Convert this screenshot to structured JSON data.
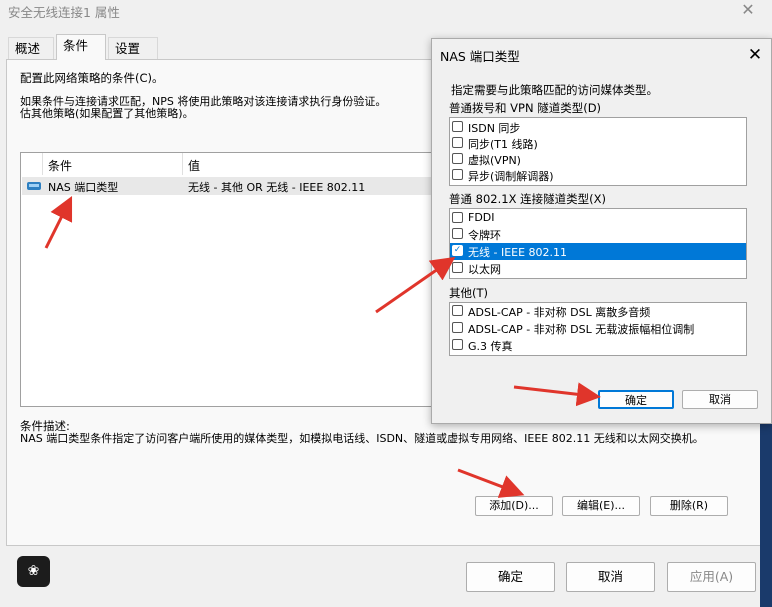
{
  "main": {
    "title": "安全无线连接1 属性",
    "close_glyph": "✕",
    "tabs": [
      {
        "label": "概述"
      },
      {
        "label": "条件"
      },
      {
        "label": "设置"
      }
    ],
    "heading": "配置此网络策略的条件(C)。",
    "description": "如果条件与连接请求匹配，NPS 将使用此策略对该连接请求执行身份验证。如果条件与连接请求不匹配，NPS 将跳过此策略并评估其他策略(如果配置了其他策略)。",
    "description_visible": "如果条件与连接请求匹配，NPS 将使用此策略对该连接请求执行身份验证。\n估其他策略(如果配置了其他策略)。",
    "table": {
      "headers": [
        "条件",
        "值"
      ],
      "rows": [
        {
          "condition": "NAS 端口类型",
          "value": "无线 - 其他 OR 无线 - IEEE 802.11"
        }
      ]
    },
    "condition_desc_label": "条件描述:",
    "condition_desc": "NAS 端口类型条件指定了访问客户端所使用的媒体类型，如模拟电话线、ISDN、隧道或虚拟专用网络、IEEE 802.11 无线和以太网交换机。",
    "buttons": {
      "add": "添加(D)...",
      "edit": "编辑(E)...",
      "delete": "删除(R)",
      "ok": "确定",
      "cancel": "取消",
      "apply": "应用(A)"
    },
    "app_icon_glyph": "❀"
  },
  "dialog": {
    "title": "NAS 端口类型",
    "close_glyph": "✕",
    "instruction": "指定需要与此策略匹配的访问媒体类型。",
    "groups": [
      {
        "label": "普通拨号和 VPN 隧道类型(D)",
        "items": [
          {
            "label": "ISDN 同步",
            "checked": false,
            "selected": false
          },
          {
            "label": "同步(T1 线路)",
            "checked": false,
            "selected": false
          },
          {
            "label": "虚拟(VPN)",
            "checked": false,
            "selected": false
          },
          {
            "label": "异步(调制解调器)",
            "checked": false,
            "selected": false
          }
        ]
      },
      {
        "label": "普通 802.1X 连接隧道类型(X)",
        "items": [
          {
            "label": "FDDI",
            "checked": false,
            "selected": false
          },
          {
            "label": "令牌环",
            "checked": false,
            "selected": false
          },
          {
            "label": "无线 - IEEE 802.11",
            "checked": true,
            "selected": true
          },
          {
            "label": "以太网",
            "checked": false,
            "selected": false
          }
        ]
      },
      {
        "label": "其他(T)",
        "items": [
          {
            "label": "ADSL-CAP - 非对称 DSL 离散多音频",
            "checked": false,
            "selected": false
          },
          {
            "label": "ADSL-CAP - 非对称 DSL 无载波振幅相位调制",
            "checked": false,
            "selected": false
          },
          {
            "label": "G.3 传真",
            "checked": false,
            "selected": false
          }
        ]
      }
    ],
    "buttons": {
      "ok": "确定",
      "cancel": "取消"
    },
    "check_glyph": "✓"
  },
  "colors": {
    "selection": "#0078d7",
    "annotation_arrow": "#e0352b"
  }
}
